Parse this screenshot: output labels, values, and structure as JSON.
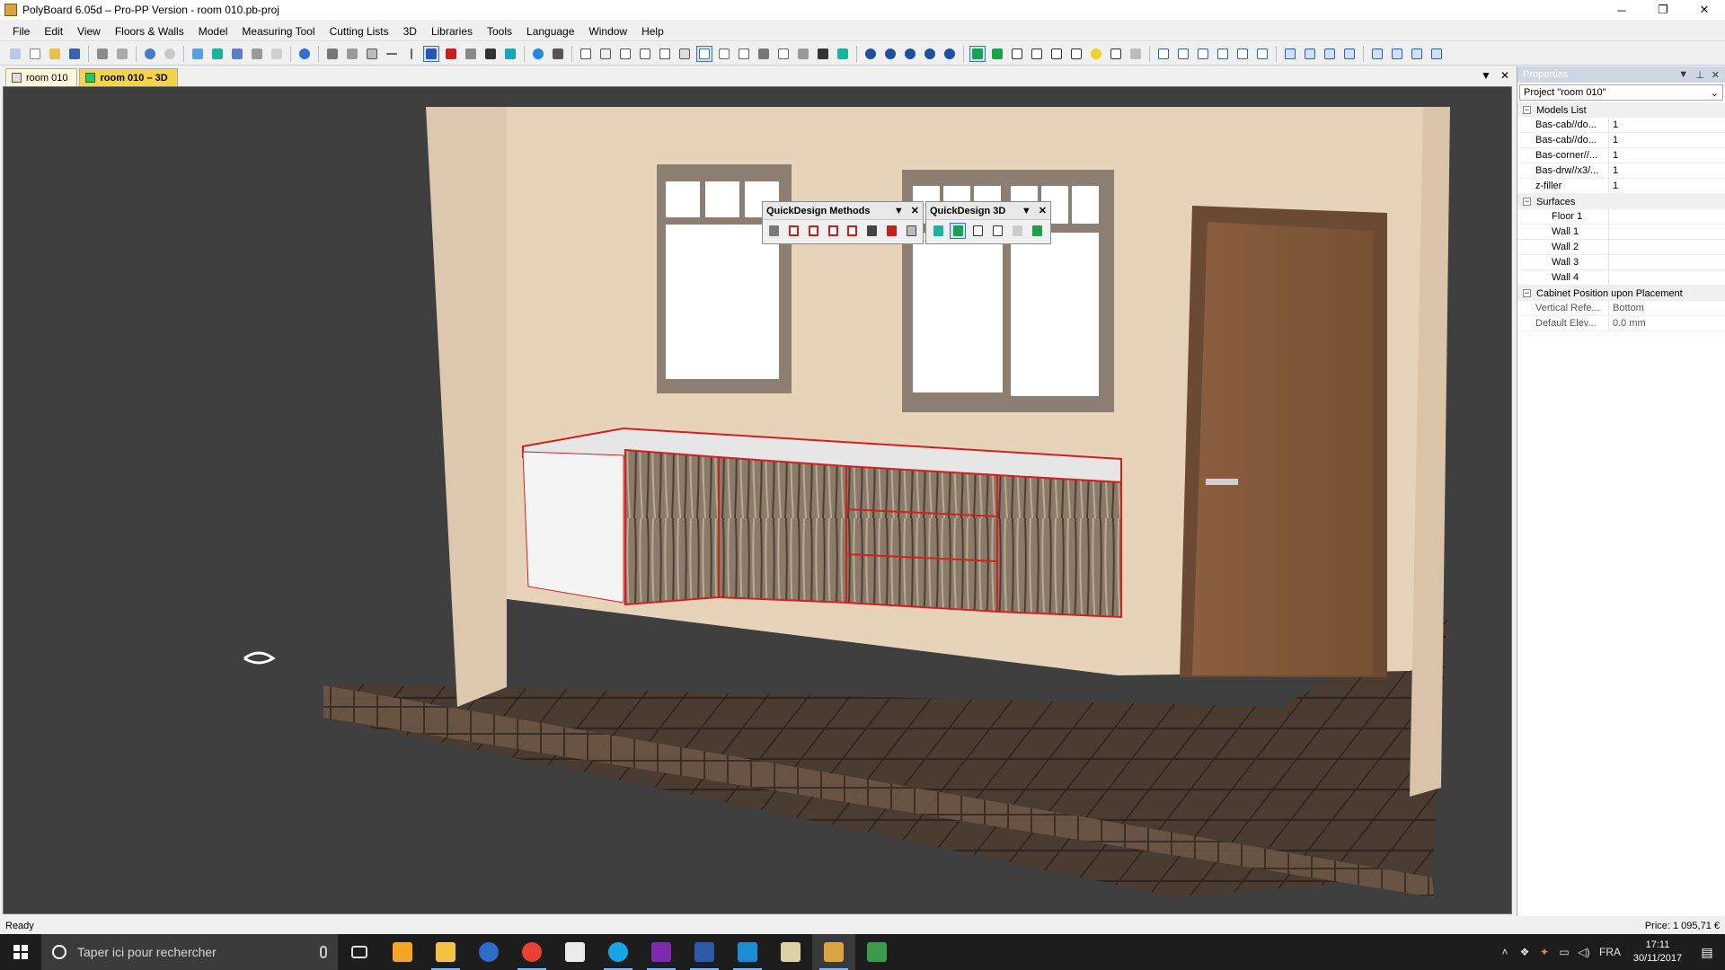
{
  "window": {
    "title": "PolyBoard 6.05d – Pro-PP Version - room 010.pb-proj",
    "controls": [
      "─",
      "❐",
      "✕"
    ]
  },
  "menu": [
    "File",
    "Edit",
    "View",
    "Floors & Walls",
    "Model",
    "Measuring Tool",
    "Cutting Lists",
    "3D",
    "Libraries",
    "Tools",
    "Language",
    "Window",
    "Help"
  ],
  "tabs": [
    {
      "label": "room 010",
      "active": false
    },
    {
      "label": "room 010 – 3D",
      "active": true
    }
  ],
  "tab_controls": {
    "dropdown": "▼",
    "close": "✕"
  },
  "quickdesign_methods": {
    "title": "QuickDesign Methods",
    "dropdown": "▼",
    "close": "✕"
  },
  "quickdesign_3d": {
    "title": "QuickDesign 3D",
    "dropdown": "▼",
    "close": "✕"
  },
  "properties": {
    "title": "Properties",
    "controls": [
      "▼",
      "⊥",
      "✕"
    ],
    "project": "Project \"room 010\"",
    "models_group": "Models List",
    "models": [
      {
        "name": "Bas-cab//do...",
        "value": "1"
      },
      {
        "name": "Bas-cab//do...",
        "value": "1"
      },
      {
        "name": "Bas-corner//...",
        "value": "1"
      },
      {
        "name": "Bas-drw//x3/...",
        "value": "1"
      },
      {
        "name": "z-filler",
        "value": "1"
      }
    ],
    "surfaces_group": "Surfaces",
    "surfaces": [
      "Floor 1",
      "Wall 1",
      "Wall 2",
      "Wall 3",
      "Wall 4"
    ],
    "placement_group": "Cabinet Position upon Placement",
    "placement": [
      {
        "name": "Vertical Refe...",
        "value": "Bottom"
      },
      {
        "name": "Default Elev...",
        "value": "0.0 mm"
      }
    ]
  },
  "status": {
    "left": "Ready",
    "right": "Price: 1 095,71 €"
  },
  "taskbar": {
    "search_placeholder": "Taper ici pour rechercher",
    "language": "FRA",
    "time": "17:11",
    "date": "30/11/2017"
  },
  "colors": {
    "wall": "#e7d3b9",
    "floor": "#4a3a30",
    "viewport_bg": "#3f3f3f",
    "accent_tab": "#f6d34a",
    "cabinet_edge": "#d22020"
  }
}
